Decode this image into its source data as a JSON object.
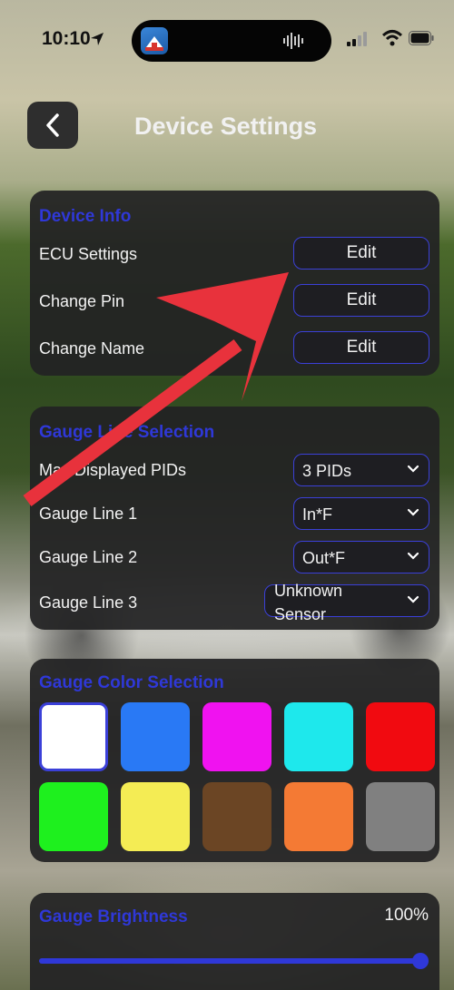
{
  "status_bar": {
    "time": "10:10"
  },
  "header": {
    "title": "Device Settings"
  },
  "device_info": {
    "title": "Device Info",
    "rows": [
      {
        "label": "ECU Settings",
        "button": "Edit"
      },
      {
        "label": "Change Pin",
        "button": "Edit"
      },
      {
        "label": "Change Name",
        "button": "Edit"
      }
    ]
  },
  "gauge_line": {
    "title": "Gauge Line Selection",
    "rows": [
      {
        "label": "Max Displayed PIDs",
        "value": "3 PIDs"
      },
      {
        "label": "Gauge Line 1",
        "value": "In*F"
      },
      {
        "label": "Gauge Line 2",
        "value": "Out*F"
      },
      {
        "label": "Gauge Line 3",
        "value": "Unknown Sensor"
      }
    ]
  },
  "gauge_color": {
    "title": "Gauge Color Selection",
    "selected_index": 0,
    "colors": [
      "#ffffff",
      "#2979f5",
      "#f012f0",
      "#1ee8ec",
      "#f10a10",
      "#1ef01e",
      "#f4ec54",
      "#6b4524",
      "#f47a34",
      "#808080"
    ]
  },
  "gauge_brightness": {
    "title": "Gauge Brightness",
    "value_label": "100%",
    "value": 1.0
  },
  "accent_color": "#2f38d8",
  "annotation_color": "#e8323c"
}
